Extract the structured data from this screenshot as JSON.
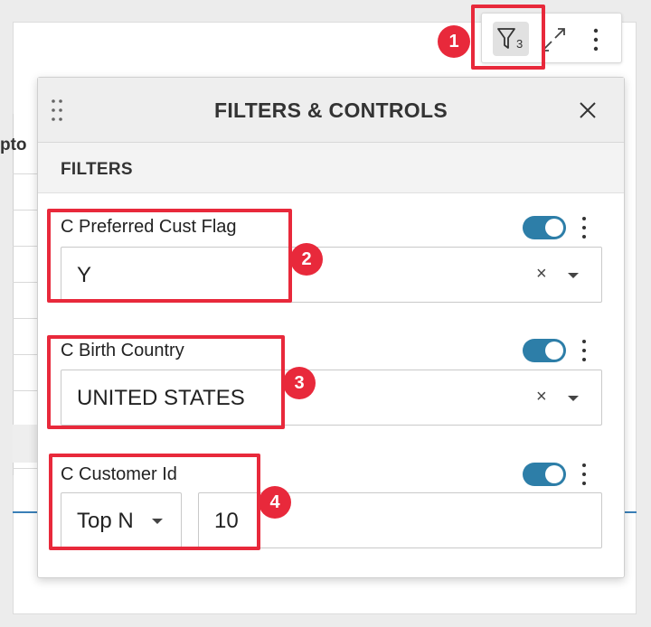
{
  "background": {
    "column_header_fragment": "pto"
  },
  "toolbar": {
    "filter_count": "3",
    "filter_icon": "filter-icon",
    "expand_icon": "expand-icon",
    "more_icon": "more-vertical-icon"
  },
  "panel": {
    "title": "FILTERS & CONTROLS",
    "close_icon": "close-icon",
    "drag_icon": "drag-handle-icon",
    "section_title": "FILTERS",
    "filters": [
      {
        "label": "C Preferred Cust Flag",
        "value": "Y",
        "enabled": true
      },
      {
        "label": "C Birth Country",
        "value": "UNITED STATES",
        "enabled": true
      },
      {
        "label": "C Customer Id",
        "mode": "Top N",
        "value": "10",
        "enabled": true
      }
    ]
  },
  "annotations": [
    "1",
    "2",
    "3",
    "4"
  ],
  "colors": {
    "highlight": "#e8293b",
    "toggle_on": "#2d7ea8",
    "accent_line": "#3a7fb7"
  }
}
